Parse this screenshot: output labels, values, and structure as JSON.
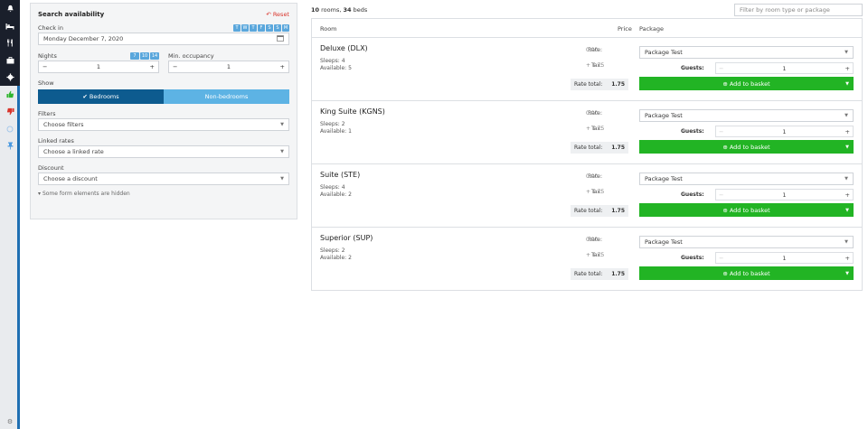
{
  "rail": {
    "icons": [
      "bell-icon",
      "bed-icon",
      "cutlery-icon",
      "briefcase-icon",
      "gear-icon",
      "thumbs-up-icon",
      "thumbs-down-icon",
      "circle-icon",
      "pin-icon"
    ]
  },
  "search": {
    "title": "Search availability",
    "reset_label": "Reset",
    "checkin_label": "Check in",
    "weekdays": [
      "T",
      "W",
      "T",
      "F",
      "S",
      "S",
      "M"
    ],
    "checkin_value": "Monday December 7, 2020",
    "nights_label": "Nights",
    "night_presets": [
      "7",
      "10",
      "14"
    ],
    "nights_value": "1",
    "min_occupancy_label": "Min. occupancy",
    "min_occupancy_value": "1",
    "show_label": "Show",
    "show_bedrooms": "Bedrooms",
    "show_nonbedrooms": "Non-bedrooms",
    "filters_label": "Filters",
    "filters_placeholder": "Choose filters",
    "linked_rates_label": "Linked rates",
    "linked_rates_placeholder": "Choose a linked rate",
    "discount_label": "Discount",
    "discount_placeholder": "Choose a discount",
    "hidden_note": "Some form elements are hidden"
  },
  "results": {
    "rooms_count": "10",
    "rooms_word": "rooms,",
    "beds_count": "34",
    "beds_word": "beds",
    "filter_placeholder": "Filter by room type or package",
    "col_room": "Room",
    "col_price": "Price",
    "col_package": "Package",
    "rate_label": "Rate:",
    "tax_label": "Tax:",
    "ratetotal_label": "Rate total:",
    "guests_label": "Guests:",
    "add_label": "Add to basket",
    "rooms": [
      {
        "name": "Deluxe (DLX)",
        "sleeps": "Sleeps: 4",
        "available": "Available: 5",
        "rate": "0.00",
        "tax": "+ 1.75",
        "total": "1.75",
        "package": "Package Test",
        "guests": "1"
      },
      {
        "name": "King Suite (KGNS)",
        "sleeps": "Sleeps: 2",
        "available": "Available: 1",
        "rate": "0.00",
        "tax": "+ 1.75",
        "total": "1.75",
        "package": "Package Test",
        "guests": "1"
      },
      {
        "name": "Suite (STE)",
        "sleeps": "Sleeps: 4",
        "available": "Available: 2",
        "rate": "0.00",
        "tax": "+ 1.75",
        "total": "1.75",
        "package": "Package Test",
        "guests": "1"
      },
      {
        "name": "Superior (SUP)",
        "sleeps": "Sleeps: 2",
        "available": "Available: 2",
        "rate": "0.00",
        "tax": "+ 1.75",
        "total": "1.75",
        "package": "Package Test",
        "guests": "1"
      }
    ]
  },
  "colors": {
    "accent": "#1f6fb2",
    "toggle_active": "#0d5b8f",
    "toggle_inactive": "#5db3e4",
    "add_button": "#22b424",
    "reset": "#d9342b"
  }
}
